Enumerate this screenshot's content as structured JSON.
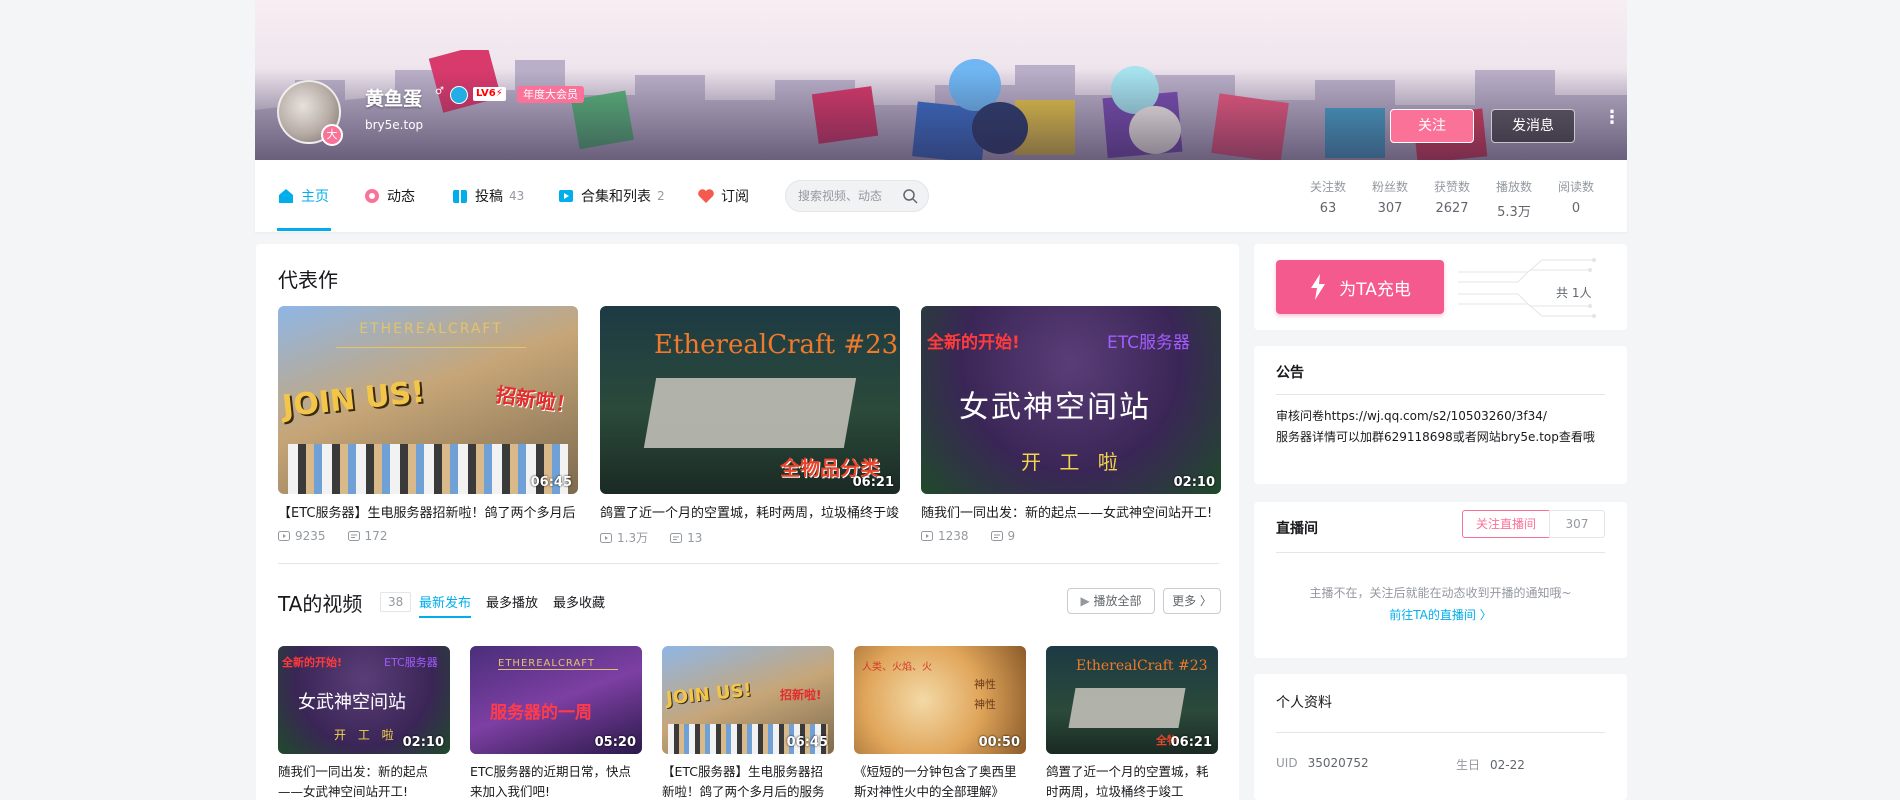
{
  "header": {
    "username": "黄鱼蛋",
    "gender_symbol": "♂",
    "level": "LV6⚡",
    "vip_label": "年度大会员",
    "sign": "bry5e.top",
    "avatar_badge": "大",
    "follow_label": "关注",
    "message_label": "发消息",
    "more_symbol": "⋮"
  },
  "nav": {
    "items": [
      {
        "label": "主页",
        "count": "",
        "icon": "home-icon",
        "color": "#00aeec"
      },
      {
        "label": "动态",
        "count": "",
        "icon": "dynamic-icon",
        "color": "#fb7299"
      },
      {
        "label": "投稿",
        "count": "43",
        "icon": "upload-icon",
        "color": "#00aeec"
      },
      {
        "label": "合集和列表",
        "count": "2",
        "icon": "collection-icon",
        "color": "#00aeec"
      },
      {
        "label": "订阅",
        "count": "",
        "icon": "heart-icon",
        "color": "#f45a4d"
      }
    ],
    "search_placeholder": "搜索视频、动态",
    "stats": [
      {
        "label": "关注数",
        "value": "63"
      },
      {
        "label": "粉丝数",
        "value": "307"
      },
      {
        "label": "获赞数",
        "value": "2627"
      },
      {
        "label": "播放数",
        "value": "5.3万"
      },
      {
        "label": "阅读数",
        "value": "0"
      }
    ]
  },
  "featured": {
    "title": "代表作",
    "videos": [
      {
        "title": "【ETC服务器】生电服务器招新啦！鸽了两个多月后",
        "duration": "06:45",
        "plays": "9235",
        "danmaku": "172",
        "thumb_text": "JOIN US!",
        "thumb_text2": "招新啦！",
        "theme": "a"
      },
      {
        "title": "鸽置了近一个月的空置城，耗时两周，垃圾桶终于竣",
        "duration": "06:21",
        "plays": "1.3万",
        "danmaku": "13",
        "thumb_text": "EtherealCraft #23",
        "thumb_text2": "全物品分类",
        "theme": "b"
      },
      {
        "title": "随我们一同出发：新的起点——女武神空间站开工!",
        "duration": "02:10",
        "plays": "1238",
        "danmaku": "9",
        "thumb_text": "女武神空间站",
        "thumb_text2": "开 工 啦",
        "thumb_text3": "全新的开始!",
        "thumb_text4": "ETC服务器",
        "theme": "c"
      }
    ]
  },
  "videos": {
    "title": "TA的视频",
    "count": "38",
    "sorts": [
      "最新发布",
      "最多播放",
      "最多收藏"
    ],
    "play_all": "播放全部",
    "more": "更多",
    "items": [
      {
        "title": "随我们一同出发：新的起点——女武神空间站开工!",
        "duration": "02:10",
        "theme": "c",
        "thumb_text": "女武神空间站",
        "thumb_text2": "开 工 啦"
      },
      {
        "title": "ETC服务器的近期日常，快点来加入我们吧!",
        "duration": "05:20",
        "theme": "d",
        "thumb_text": "服务器的一周",
        "thumb_text2": ""
      },
      {
        "title": "【ETC服务器】生电服务器招新啦！鸽了两个多月后的服务",
        "duration": "06:45",
        "theme": "a",
        "thumb_text": "JOIN US!",
        "thumb_text2": "招新啦!"
      },
      {
        "title": "《短短的一分钟包含了奥西里斯对神性火中的全部理解》",
        "duration": "00:50",
        "theme": "e",
        "thumb_text": "神性",
        "thumb_text2": "神性"
      },
      {
        "title": "鸽置了近一个月的空置城，耗时两周，垃圾桶终于竣工",
        "duration": "06:21",
        "theme": "b",
        "thumb_text": "EtherealCraft #23",
        "thumb_text2": "全物"
      }
    ]
  },
  "charge": {
    "button_label": "为TA充电",
    "total": "共 1人"
  },
  "notice": {
    "title": "公告",
    "line1": "审核问卷https://wj.qq.com/s2/10503260/3f34/",
    "line2": "服务器详情可以加群629118698或者网站bry5e.top查看哦"
  },
  "live": {
    "title": "直播间",
    "follow_label": "关注直播间",
    "follow_count": "307",
    "message": "主播不在，关注后就能在动态收到开播的通知哦~",
    "link": "前往TA的直播间 〉"
  },
  "profile": {
    "title": "个人资料",
    "uid_label": "UID",
    "uid": "35020752",
    "birthday_label": "生日",
    "birthday": "02-22"
  }
}
